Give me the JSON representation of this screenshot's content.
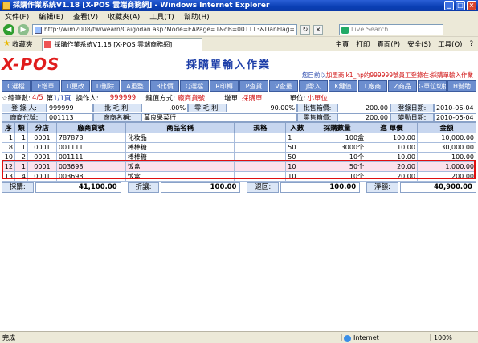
{
  "window": {
    "title": "採購作業系統V1.18 [X-POS 雲端商務網] - Windows Internet Explorer",
    "min": "_",
    "max": "□",
    "close": "×"
  },
  "menu": [
    "文件(F)",
    "編輯(E)",
    "查看(V)",
    "收藏夾(A)",
    "工具(T)",
    "幫助(H)"
  ],
  "address": {
    "back": "◀",
    "forward": "▶",
    "url": "http://wim2008/tw/wearn/Caigodan.asp?Mode=EAPage=1&dB=001113&DanFlag=1&GetEan=False&AutoE",
    "refresh": "↻",
    "stop": "×",
    "search_placeholder": "Live Search"
  },
  "tabbar": {
    "favorites": "收藏夾",
    "tab_title": "採購作業系統V1.18 [X-POS 雲端商務網]",
    "tools": [
      "主頁",
      "打印",
      "頁面(P)",
      "安全(S)",
      "工具(O)",
      "?"
    ]
  },
  "app": {
    "logo": "X-POS",
    "page_title": "採購單輸入作業",
    "sysmsg_prefix": "您目前以",
    "sysmsg_user": "加盟商ik1_np的999999號員工登錄在:",
    "sysmsg_suffix": "採購單輸入作業",
    "function_buttons": [
      "C選檔",
      "E增單",
      "U更改",
      "D刪除",
      "A重整",
      "B比價",
      "Q選檔",
      "R印轉",
      "P查貨",
      "V查量",
      "J帶入",
      "K鍵值",
      "L廠商",
      "Z商品",
      "G單位切換",
      "H幫助"
    ],
    "info1": {
      "total_label": "☆總筆數:",
      "total_val": "4/5",
      "page_label": "第",
      "page_val": "1/1頁",
      "operator_label": "操作人:",
      "operator_val": "999999",
      "key_label": "鍵值方式:",
      "key_val": "廠商貨號",
      "add_label": "增單:",
      "add_val": "採購單",
      "unit_label": "單位:",
      "unit_val": "小單位"
    },
    "info2": {
      "entry_label": "登 錄 人:",
      "entry_val": "999999",
      "wholesale_label": "批 毛 利:",
      "wholesale_val": ".00%",
      "retail_label": "零 毛 利:",
      "retail_val": "90.00%",
      "sale_box_label": "批售箱價:",
      "sale_box_val": "200.00",
      "login_date_label": "登錄日期:",
      "login_date_val": "2010-06-04"
    },
    "info3": {
      "vendor_code_label": "廠商代號:",
      "vendor_code_val": "001113",
      "vendor_name_label": "廠商名稱:",
      "vendor_name_val": "萬良果菜行",
      "retail_box_label": "零售箱價:",
      "retail_box_val": "200.00",
      "change_date_label": "變動日期:",
      "change_date_val": "2010-06-04"
    },
    "grid": {
      "headers": [
        "序",
        "類",
        "分店",
        "廠商貨號",
        "商品名稱",
        "規格",
        "入數",
        "採購數量",
        "進 單價",
        "金額"
      ],
      "rows": [
        {
          "seq": "1",
          "type": "1",
          "store": "0001",
          "sku": "787878",
          "name": "化妆品",
          "spec": "",
          "qty_in": "1",
          "qty": "100盒",
          "price": "100.00",
          "amount": "10,000.00"
        },
        {
          "seq": "8",
          "type": "1",
          "store": "0001",
          "sku": "001111",
          "name": "棒棒糖",
          "spec": "",
          "qty_in": "50",
          "qty": "3000个",
          "price": "10.00",
          "amount": "30,000.00"
        },
        {
          "seq": "10",
          "type": "2",
          "store": "0001",
          "sku": "001111",
          "name": "棒棒糖",
          "spec": "",
          "qty_in": "50",
          "qty": "10个",
          "price": "10.00",
          "amount": "100.00"
        },
        {
          "seq": "12",
          "type": "1",
          "store": "0001",
          "sku": "003698",
          "name": "饭盒",
          "spec": "",
          "qty_in": "10",
          "qty": "50个",
          "price": "20.00",
          "amount": "1,000.00"
        },
        {
          "seq": "13",
          "type": "4",
          "store": "0001",
          "sku": "003698",
          "name": "饭盒",
          "spec": "",
          "qty_in": "10",
          "qty": "10个",
          "price": "20.00",
          "amount": "200.00"
        }
      ]
    },
    "totals": {
      "purchase_label": "採購:",
      "purchase_val": "41,100.00",
      "discount_label": "折讓:",
      "discount_val": "100.00",
      "return_label": "退回:",
      "return_val": "100.00",
      "net_label": "淨額:",
      "net_val": "40,900.00"
    }
  },
  "status": {
    "left": "完成",
    "zone": "Internet",
    "zoom": "100%"
  },
  "colors": {
    "accent": "#1d3ea8",
    "logo": "#e01c1c",
    "highlight_row": "#fbe2ec",
    "button": "#6c8ecf",
    "frame": "#e01010"
  }
}
